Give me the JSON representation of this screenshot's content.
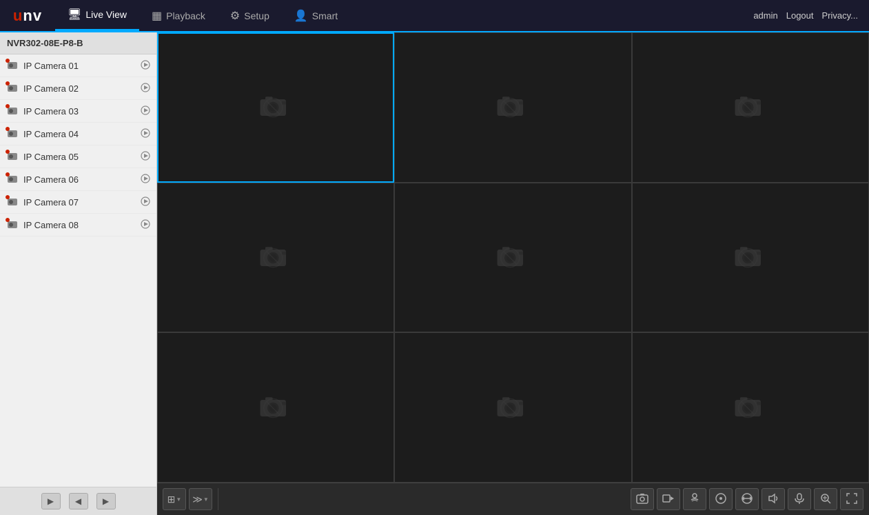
{
  "header": {
    "logo": "UNV",
    "nav": [
      {
        "id": "live-view",
        "label": "Live View",
        "icon": "🖥",
        "active": true
      },
      {
        "id": "playback",
        "label": "Playback",
        "icon": "▦",
        "active": false
      },
      {
        "id": "setup",
        "label": "Setup",
        "icon": "⚙",
        "active": false
      },
      {
        "id": "smart",
        "label": "Smart",
        "icon": "👤",
        "active": false
      }
    ],
    "user": "admin",
    "logout_label": "Logout",
    "privacy_label": "Privacy..."
  },
  "sidebar": {
    "title": "NVR302-08E-P8-B",
    "cameras": [
      {
        "id": 1,
        "name": "IP Camera 01"
      },
      {
        "id": 2,
        "name": "IP Camera 02"
      },
      {
        "id": 3,
        "name": "IP Camera 03"
      },
      {
        "id": 4,
        "name": "IP Camera 04"
      },
      {
        "id": 5,
        "name": "IP Camera 05"
      },
      {
        "id": 6,
        "name": "IP Camera 06"
      },
      {
        "id": 7,
        "name": "IP Camera 07"
      },
      {
        "id": 8,
        "name": "IP Camera 08"
      }
    ],
    "nav_prev": "◀",
    "nav_left": "◂",
    "nav_right": "▸"
  },
  "video_grid": {
    "cells": [
      {
        "id": 1,
        "active": true
      },
      {
        "id": 2,
        "active": false
      },
      {
        "id": 3,
        "active": false
      },
      {
        "id": 4,
        "active": false
      },
      {
        "id": 5,
        "active": false
      },
      {
        "id": 6,
        "active": false
      },
      {
        "id": 7,
        "active": false
      },
      {
        "id": 8,
        "active": false
      },
      {
        "id": 9,
        "active": false
      }
    ]
  },
  "toolbar": {
    "layout_icon": "⊞",
    "sequence_icon": "▶▶",
    "snapshot_icon": "📷",
    "record_icon": "🎬",
    "audio_icon": "🎧",
    "ptz_icon": "⊕",
    "flip_icon": "↔",
    "color_icon": "🔊",
    "camera_ctl_icon": "📷",
    "zoom_icon": "🔍",
    "fullscreen_icon": "⛶"
  }
}
